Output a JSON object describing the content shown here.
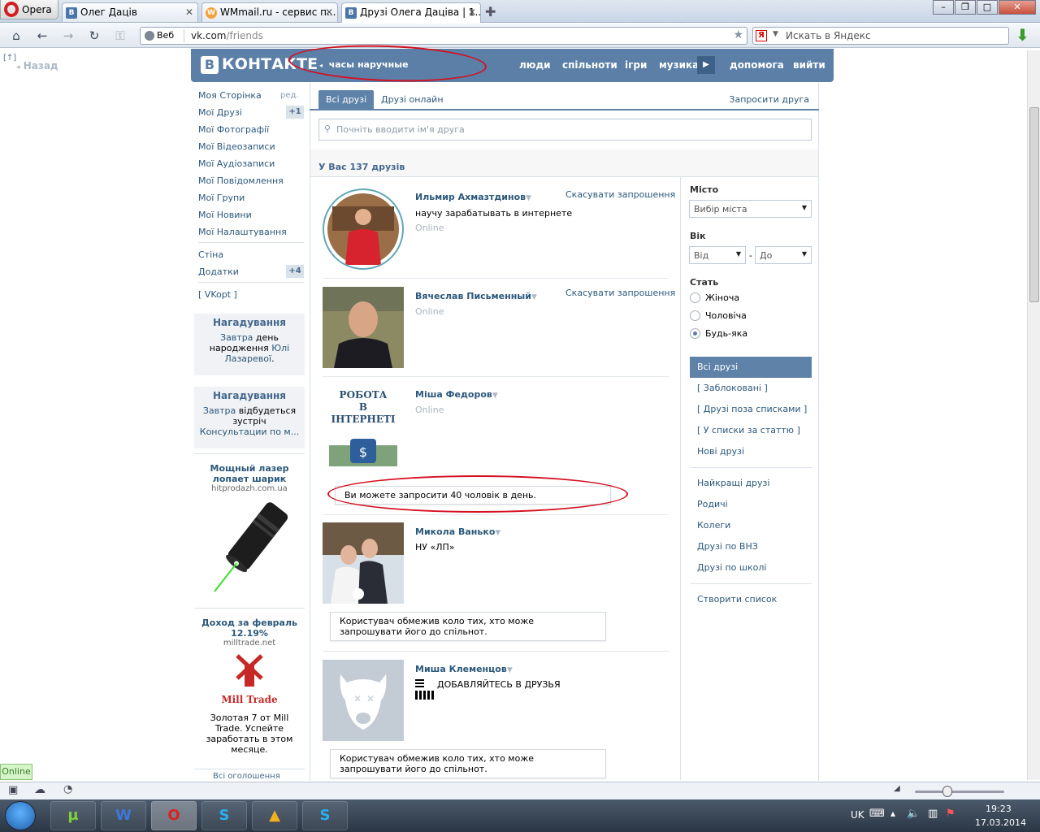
{
  "browser": {
    "menu_label": "Opera",
    "tabs": [
      {
        "title": "Олег Даців",
        "favicon": "В"
      },
      {
        "title": "WMmail.ru - сервис п...",
        "favicon": "W"
      },
      {
        "title": "Друзі Олега Даціва | 1...",
        "favicon": "В"
      }
    ],
    "address": {
      "chip": "Веб",
      "domain": "vk.com",
      "path": "/friends"
    },
    "search_placeholder": "Искать в Яндекс",
    "search_engine_glyph": "Я"
  },
  "side": {
    "back": "Назад",
    "corner": "[↑]"
  },
  "vk_header": {
    "logo_letter": "В",
    "logo_text": "КОНТАКТЕ",
    "status": "часы наручные",
    "nav": [
      "люди",
      "спільноти",
      "ігри",
      "музика",
      "допомога",
      "вийти"
    ],
    "accent": "#5b7fa6"
  },
  "left_menu": {
    "edit": "ред.",
    "items": [
      "Моя Сторінка",
      "Мої Друзі",
      "Мої Фотографії",
      "Мої Відеозаписи",
      "Мої Аудіозаписи",
      "Мої Повідомлення",
      "Мої Групи",
      "Мої Новини",
      "Мої Налаштування"
    ],
    "friends_badge": "+1",
    "extra": [
      "Стіна",
      "Додатки"
    ],
    "apps_badge": "+4",
    "vkopt": "[ VKopt ]"
  },
  "reminders": [
    {
      "title": "Нагадування",
      "link1": "Завтра",
      "text1": " день народження ",
      "link2": "Юлі Лазаревої",
      "text2": "."
    },
    {
      "title": "Нагадування",
      "link1": "Завтра",
      "text1": " відбудеться зустріч ",
      "link2": "Консультации по м...",
      "text2": ""
    }
  ],
  "ads": [
    {
      "title": "Мощный лазер лопает шарик",
      "domain": "hitprodazh.com.ua"
    },
    {
      "title": "Доход за февраль 12.19%",
      "domain": "milltrade.net",
      "logo_text": "Mill Trade",
      "text": "Золотая 7 от Mill Trade. Успейте заработать в этом месяце."
    }
  ],
  "all_ads": "Всі оголошення",
  "tabs": {
    "all": "Всі друзі",
    "online": "Друзі онлайн",
    "invite": "Запросити друга"
  },
  "search_placeholder": "Почніть вводити ім'я друга",
  "count_text": "У Вас 137 друзів",
  "friends": [
    {
      "name": "Ильмир Ахмазтдинов",
      "sub": "научу зарабатывать в интернете",
      "online": "Online",
      "action": "Скасувати запрошення"
    },
    {
      "name": "Вячеслав Письменный",
      "sub": "",
      "online": "Online",
      "action": "Скасувати запрошення"
    },
    {
      "name": "Міша Федоров",
      "sub": "",
      "online": "Online",
      "action": "",
      "photo_text": [
        "РОБОТА",
        "В",
        "ІНТЕРНЕТІ"
      ]
    },
    {
      "name": "Микола Ванько",
      "sub": "НУ «ЛП»",
      "online": "",
      "action": ""
    },
    {
      "name": "Миша Клеменцов",
      "sub": "ДОБАВЛЯЙТЕСЬ В ДРУЗЬЯ",
      "online": "",
      "action": ""
    }
  ],
  "notices": {
    "limit": "Ви можете запросити 40 чоловік в день.",
    "restricted": "Користувач обмежив коло тих, хто може запрошувати його до спільнот."
  },
  "filters": {
    "city_label": "Місто",
    "city_value": "Вибір міста",
    "age_label": "Вік",
    "age_from": "Від",
    "age_dash": "-",
    "age_to": "До",
    "sex_label": "Стать",
    "sex_options": [
      "Жіноча",
      "Чоловіча",
      "Будь-яка"
    ],
    "sex_selected": "Будь-яка",
    "active_section": "Всі друзі",
    "sections": [
      "[ Заблоковані ]",
      "[ Друзі поза списками ]",
      "[ У списки за статтю ]",
      "Нові друзі"
    ],
    "lists": [
      "Найкращі друзі",
      "Родичі",
      "Колеги",
      "Друзі по ВНЗ",
      "Друзі по школі"
    ],
    "create": "Створити список"
  },
  "status": {
    "online": "Online"
  },
  "taskbar": {
    "lang": "UK",
    "time": "19:23",
    "date": "17.03.2014"
  }
}
